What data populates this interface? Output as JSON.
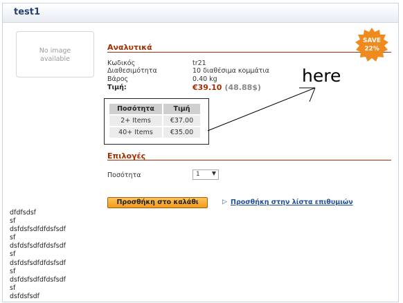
{
  "window": {
    "title": "test1"
  },
  "image_placeholder": {
    "line1": "No image",
    "line2": "available"
  },
  "badge": {
    "line1": "SAVE",
    "line2": "22%",
    "color": "#f08a1c"
  },
  "details": {
    "section_title": "Αναλυτικά",
    "rows": [
      {
        "label": "Κωδικός",
        "value": "tr21"
      },
      {
        "label": "Διαθεσιμότητα",
        "value": "10 διαθέσιμα κομμάτια"
      },
      {
        "label": "Βάρος",
        "value": "0.40 kg"
      }
    ],
    "price_label": "Τιμή:",
    "price": "€39.10",
    "price_alt": "(48.88$)"
  },
  "quantity_table": {
    "headers": [
      "Ποσότητα",
      "Τιμή"
    ],
    "rows": [
      {
        "qty": "2+ Items",
        "price": "€37.00"
      },
      {
        "qty": "40+ Items",
        "price": "€35.00"
      }
    ]
  },
  "annotation": {
    "text": "here"
  },
  "options": {
    "section_title": "Επιλογές",
    "quantity_label": "Ποσότητα",
    "quantity_value": "1"
  },
  "actions": {
    "add_to_cart": "Προσθήκη στο καλάθι",
    "add_to_wishlist": "Προσθήκη στην λίστα επιθυμιών"
  },
  "description_lines": [
    "dfdfsdsf",
    "sf",
    "dsfdsfsdfdfdsfsdf",
    "sf",
    "dsfdsfsdfdfdsfsdf",
    "sf",
    "dsfdsfsdfdfdsfsdf",
    "sf",
    "dsfdsfsdfdfdsfsdf",
    "sf",
    "dsfdsfsdf"
  ],
  "colors": {
    "accent": "#a42d00",
    "link": "#1f4f9b",
    "title": "#243f73"
  }
}
